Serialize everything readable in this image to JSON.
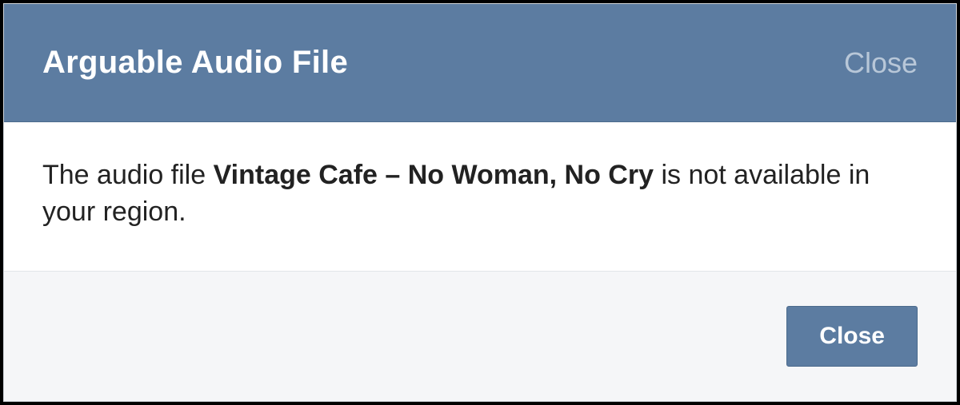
{
  "dialog": {
    "title": "Arguable Audio File",
    "header_close_label": "Close",
    "message_prefix": "The audio file ",
    "message_file": "Vintage Cafe – No Woman, No Cry",
    "message_suffix": " is not available in your region.",
    "footer_close_label": "Close"
  }
}
